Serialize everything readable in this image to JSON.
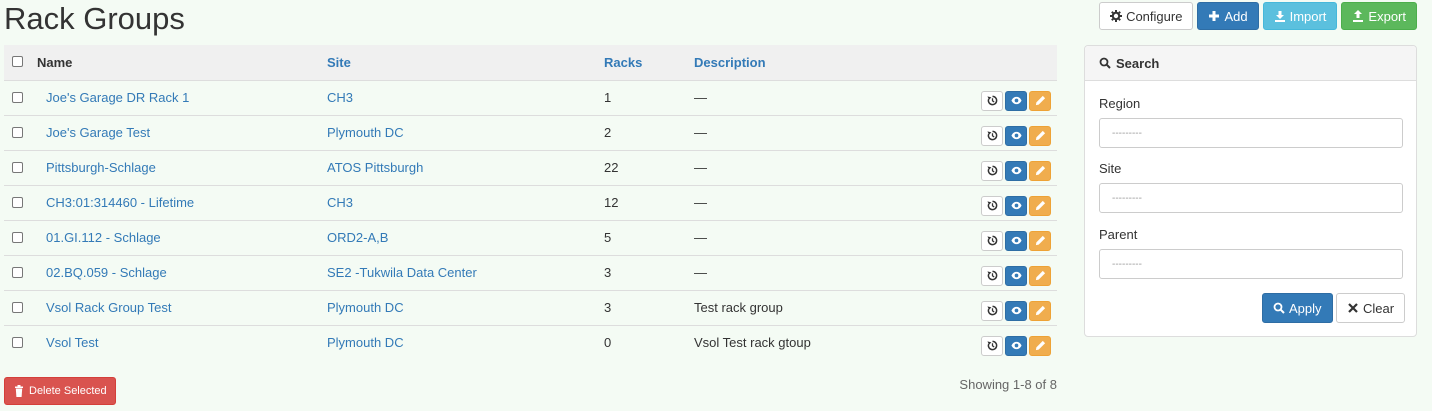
{
  "page": {
    "title": "Rack Groups"
  },
  "toolbar": {
    "configure_label": "Configure",
    "add_label": "Add",
    "import_label": "Import",
    "export_label": "Export"
  },
  "table": {
    "headers": {
      "name": "Name",
      "site": "Site",
      "racks": "Racks",
      "description": "Description"
    },
    "rows": [
      {
        "name": "Joe's Garage DR Rack 1",
        "site": "CH3",
        "racks": "1",
        "description": "—"
      },
      {
        "name": "Joe's Garage Test",
        "site": "Plymouth DC",
        "racks": "2",
        "description": "—"
      },
      {
        "name": "Pittsburgh-Schlage",
        "site": "ATOS Pittsburgh",
        "racks": "22",
        "description": "—"
      },
      {
        "name": "CH3:01:314460 - Lifetime",
        "site": "CH3",
        "racks": "12",
        "description": "—"
      },
      {
        "name": "01.GI.112 - Schlage",
        "site": "ORD2-A,B",
        "racks": "5",
        "description": "—"
      },
      {
        "name": "02.BQ.059 - Schlage",
        "site": "SE2 -Tukwila Data Center",
        "racks": "3",
        "description": "—"
      },
      {
        "name": "Vsol Rack Group Test",
        "site": "Plymouth DC",
        "racks": "3",
        "description": "Test rack group"
      },
      {
        "name": "Vsol Test",
        "site": "Plymouth DC",
        "racks": "0",
        "description": "Vsol Test rack gtoup"
      }
    ]
  },
  "footer": {
    "delete_label": "Delete Selected",
    "showing_text": "Showing 1-8 of 8"
  },
  "search_panel": {
    "title": "Search",
    "region_label": "Region",
    "region_placeholder": "---------",
    "site_label": "Site",
    "site_placeholder": "---------",
    "parent_label": "Parent",
    "parent_placeholder": "---------",
    "apply_label": "Apply",
    "clear_label": "Clear"
  },
  "colors": {
    "primary": "#337ab7",
    "info": "#5bc0de",
    "success": "#5cb85c",
    "danger": "#d9534f",
    "warning": "#f0ad4e",
    "background": "#f4fbf4"
  },
  "icons": [
    "gear-icon",
    "plus-icon",
    "import-icon",
    "export-icon",
    "history-icon",
    "eye-icon",
    "pencil-icon",
    "search-icon",
    "trash-icon",
    "close-icon"
  ]
}
